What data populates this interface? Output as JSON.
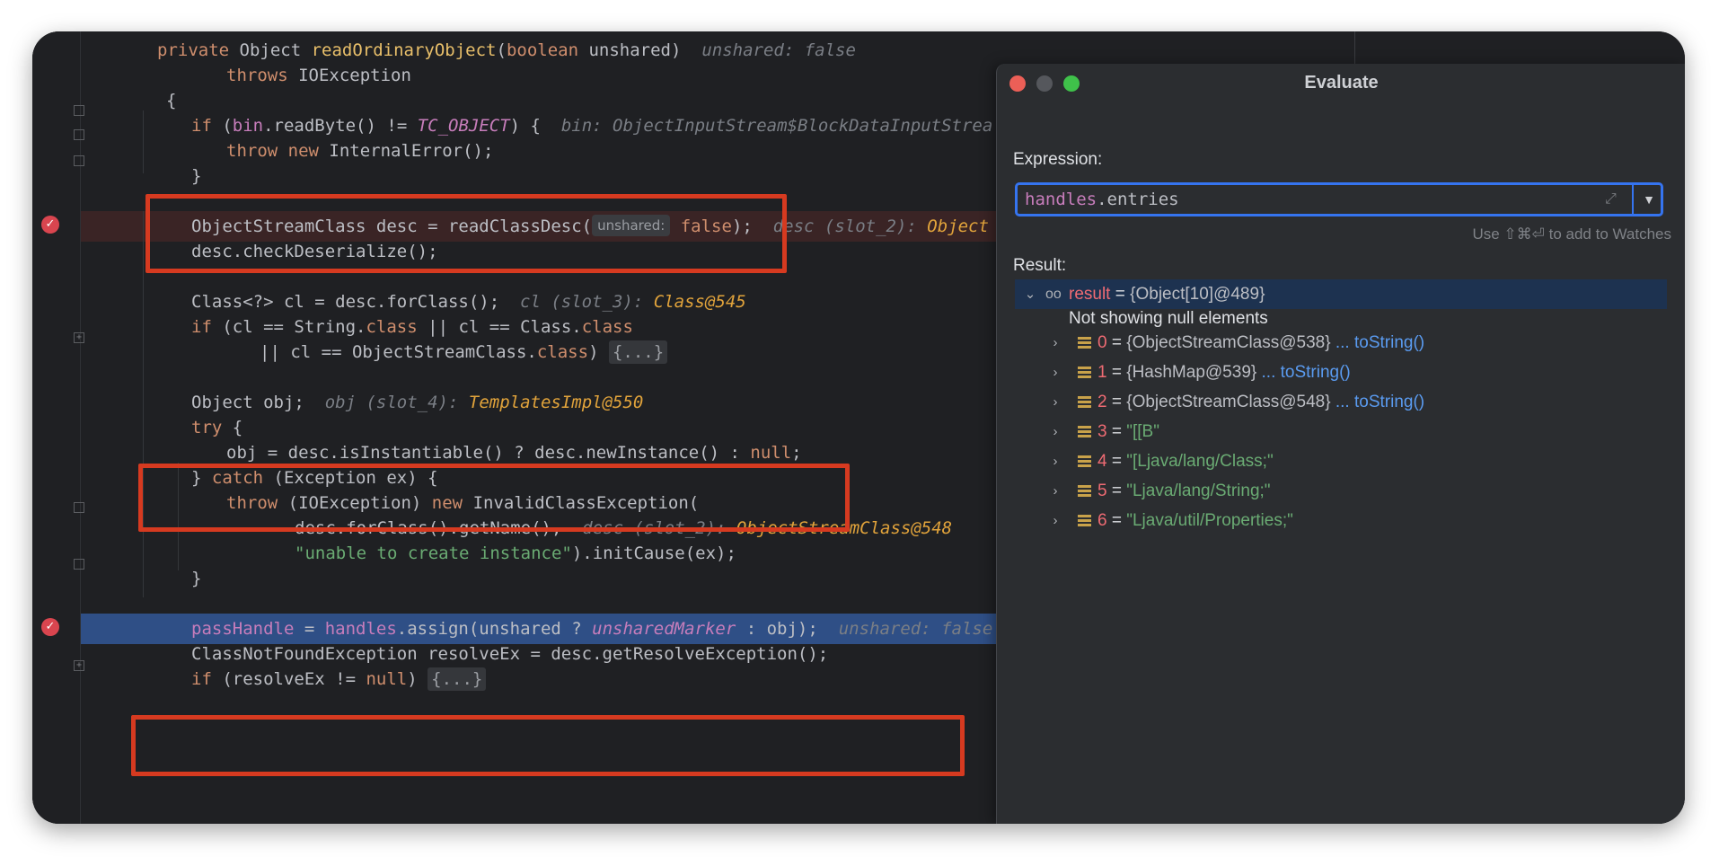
{
  "editor": {
    "lines": [
      {
        "tokens": [
          [
            "kw",
            "private "
          ],
          [
            "",
            "Object "
          ],
          [
            "fn-y",
            "readOrdinaryObject"
          ],
          [
            "",
            "("
          ],
          [
            "kw",
            "boolean "
          ],
          [
            "",
            "unshared)  "
          ],
          [
            "hint",
            "unshared: false"
          ]
        ]
      },
      {
        "tokens": [
          [
            "kw",
            "throws "
          ],
          [
            "",
            "IOException"
          ]
        ]
      },
      {
        "tokens": [
          [
            "",
            "{"
          ]
        ]
      },
      {
        "tokens": [
          [
            "kw",
            "if "
          ],
          [
            "",
            "("
          ],
          [
            "fld-n",
            "bin"
          ],
          [
            "",
            ".readByte() != "
          ],
          [
            "cst",
            "TC_OBJECT"
          ],
          [
            "",
            ") {  "
          ],
          [
            "hint",
            "bin: ObjectInputStream$BlockDataInputStrea"
          ]
        ]
      },
      {
        "tokens": [
          [
            "kw",
            "throw new "
          ],
          [
            "",
            "InternalError();"
          ]
        ]
      },
      {
        "tokens": [
          [
            "",
            "}"
          ]
        ]
      },
      {
        "tokens": [
          [
            "",
            "ObjectStreamClass desc = readClassDesc("
          ],
          [
            "param",
            "unshared:"
          ],
          [
            "kw",
            " false"
          ],
          [
            "",
            ");  "
          ],
          [
            "hint",
            "desc (slot_2): "
          ],
          [
            "hintv",
            "Object"
          ]
        ]
      },
      {
        "tokens": [
          [
            "",
            "desc.checkDeserialize();"
          ]
        ]
      },
      {
        "tokens": [
          [
            "",
            "Class<?> cl = desc.forClass();  "
          ],
          [
            "hint",
            "cl (slot_3): "
          ],
          [
            "hintv",
            "Class@545"
          ]
        ]
      },
      {
        "tokens": [
          [
            "kw",
            "if "
          ],
          [
            "",
            "(cl == String."
          ],
          [
            "kw",
            "class "
          ],
          [
            "",
            "|| cl == Class."
          ],
          [
            "kw",
            "class"
          ]
        ]
      },
      {
        "tokens": [
          [
            "",
            "|| cl == ObjectStreamClass."
          ],
          [
            "kw",
            "class"
          ],
          [
            "",
            ") "
          ],
          [
            "coll",
            "{...}"
          ]
        ]
      },
      {
        "tokens": [
          [
            "",
            "Object obj;  "
          ],
          [
            "hint",
            "obj (slot_4): "
          ],
          [
            "hintv",
            "TemplatesImpl@550"
          ]
        ]
      },
      {
        "tokens": [
          [
            "kw",
            "try "
          ],
          [
            "",
            "{"
          ]
        ]
      },
      {
        "tokens": [
          [
            "",
            "obj = desc.isInstantiable() ? desc.newInstance() : "
          ],
          [
            "kw",
            "null"
          ],
          [
            "",
            ";"
          ]
        ]
      },
      {
        "tokens": [
          [
            "",
            "} "
          ],
          [
            "kw",
            "catch "
          ],
          [
            "",
            "(Exception ex) {"
          ]
        ]
      },
      {
        "tokens": [
          [
            "kw",
            "throw "
          ],
          [
            "",
            "(IOException) "
          ],
          [
            "kw",
            "new "
          ],
          [
            "",
            "InvalidClassException("
          ]
        ]
      },
      {
        "tokens": [
          [
            "",
            "desc.forClass().getName(),  "
          ],
          [
            "hint",
            "desc (slot_2): "
          ],
          [
            "hintv",
            "ObjectStreamClass@548"
          ]
        ]
      },
      {
        "tokens": [
          [
            "str",
            "\"unable to create instance\""
          ],
          [
            "",
            ").initCause(ex);"
          ]
        ]
      },
      {
        "tokens": [
          [
            "",
            "}"
          ]
        ]
      },
      {
        "tokens": [
          [
            "fld",
            "passHandle"
          ],
          [
            "",
            " = "
          ],
          [
            "fld",
            "handles"
          ],
          [
            "",
            ".assign(unshared ? "
          ],
          [
            "cst",
            "unsharedMarker"
          ],
          [
            "",
            " : obj);  "
          ],
          [
            "hint",
            "unshared: false"
          ]
        ]
      },
      {
        "tokens": [
          [
            "",
            "ClassNotFoundException resolveEx = desc.getResolveException();"
          ]
        ]
      },
      {
        "tokens": [
          [
            "kw",
            "if "
          ],
          [
            "",
            "(resolveEx != "
          ],
          [
            "kw",
            "null"
          ],
          [
            "",
            ") "
          ],
          [
            "coll",
            "{...}"
          ]
        ]
      }
    ]
  },
  "dialog": {
    "title": "Evaluate",
    "expression_label": "Expression:",
    "expression_obj": "handles",
    "expression_rest": ".entries",
    "watch_hint": "Use ⇧⌘⏎ to add to Watches",
    "result_label": "Result:",
    "result": {
      "name": "result",
      "value": "{Object[10]@489}"
    },
    "null_note": "Not showing null elements",
    "entries": [
      {
        "index": "0",
        "value": "{ObjectStreamClass@538}",
        "kind": "obj",
        "link": "... toString()"
      },
      {
        "index": "1",
        "value": "{HashMap@539}",
        "kind": "obj",
        "link": "... toString()"
      },
      {
        "index": "2",
        "value": "{ObjectStreamClass@548}",
        "kind": "obj",
        "link": "... toString()"
      },
      {
        "index": "3",
        "value": "\"[[B\"",
        "kind": "str",
        "link": ""
      },
      {
        "index": "4",
        "value": "\"[Ljava/lang/Class;\"",
        "kind": "str",
        "link": ""
      },
      {
        "index": "5",
        "value": "\"Ljava/lang/String;\"",
        "kind": "str",
        "link": ""
      },
      {
        "index": "6",
        "value": "\"Ljava/util/Properties;\"",
        "kind": "str",
        "link": ""
      }
    ]
  },
  "colors": {
    "editor_bg": "#1f2023",
    "dialog_bg": "#2b2d30",
    "annotation_red": "#d63a20",
    "exec_line": "#2f4f86",
    "focus_blue": "#3574f0"
  }
}
